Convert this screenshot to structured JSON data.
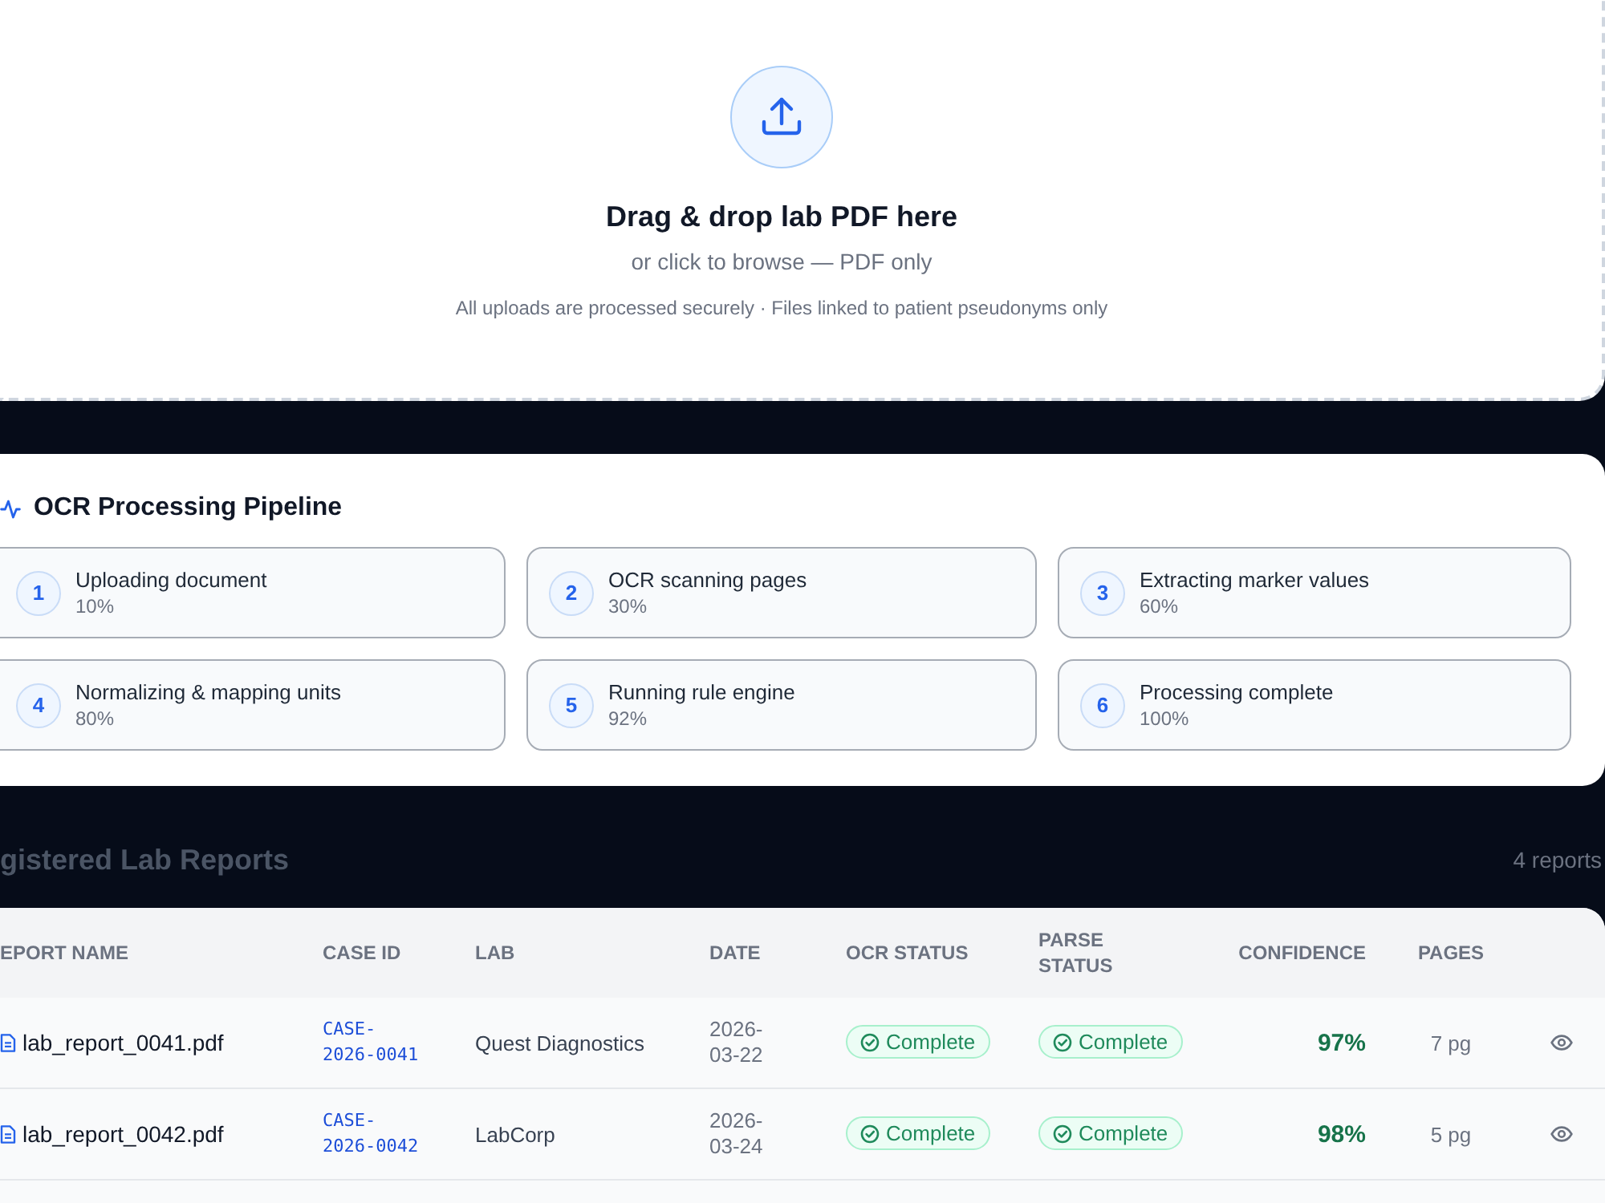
{
  "upload": {
    "title": "Drag & drop lab PDF here",
    "subtitle": "or click to browse — PDF only",
    "note": "All uploads are processed securely · Files linked to patient pseudonyms only"
  },
  "pipeline": {
    "title": "OCR Processing Pipeline",
    "steps": [
      {
        "number": "1",
        "label": "Uploading document",
        "progress": "10%"
      },
      {
        "number": "2",
        "label": "OCR scanning pages",
        "progress": "30%"
      },
      {
        "number": "3",
        "label": "Extracting marker values",
        "progress": "60%"
      },
      {
        "number": "4",
        "label": "Normalizing & mapping units",
        "progress": "80%"
      },
      {
        "number": "5",
        "label": "Running rule engine",
        "progress": "92%"
      },
      {
        "number": "6",
        "label": "Processing complete",
        "progress": "100%"
      }
    ]
  },
  "reports": {
    "title": "gistered Lab Reports",
    "count": "4 reports",
    "table": {
      "columns": [
        "EPORT NAME",
        "CASE ID",
        "LAB",
        "DATE",
        "OCR STATUS",
        "PARSE STATUS",
        "CONFIDENCE",
        "PAGES"
      ],
      "rows": [
        {
          "name": "lab_report_0041.pdf",
          "case_id": "CASE-2026-0041",
          "lab": "Quest Diagnostics",
          "date": "2026-03-22",
          "ocr_status": {
            "label": "Complete",
            "kind": "success"
          },
          "parse_status": {
            "label": "Complete",
            "kind": "success"
          },
          "confidence": "97%",
          "pages": "7 pg"
        },
        {
          "name": "lab_report_0042.pdf",
          "case_id": "CASE-2026-0042",
          "lab": "LabCorp",
          "date": "2026-03-24",
          "ocr_status": {
            "label": "Complete",
            "kind": "success"
          },
          "parse_status": {
            "label": "Complete",
            "kind": "success"
          },
          "confidence": "98%",
          "pages": "5 pg"
        }
      ]
    }
  }
}
